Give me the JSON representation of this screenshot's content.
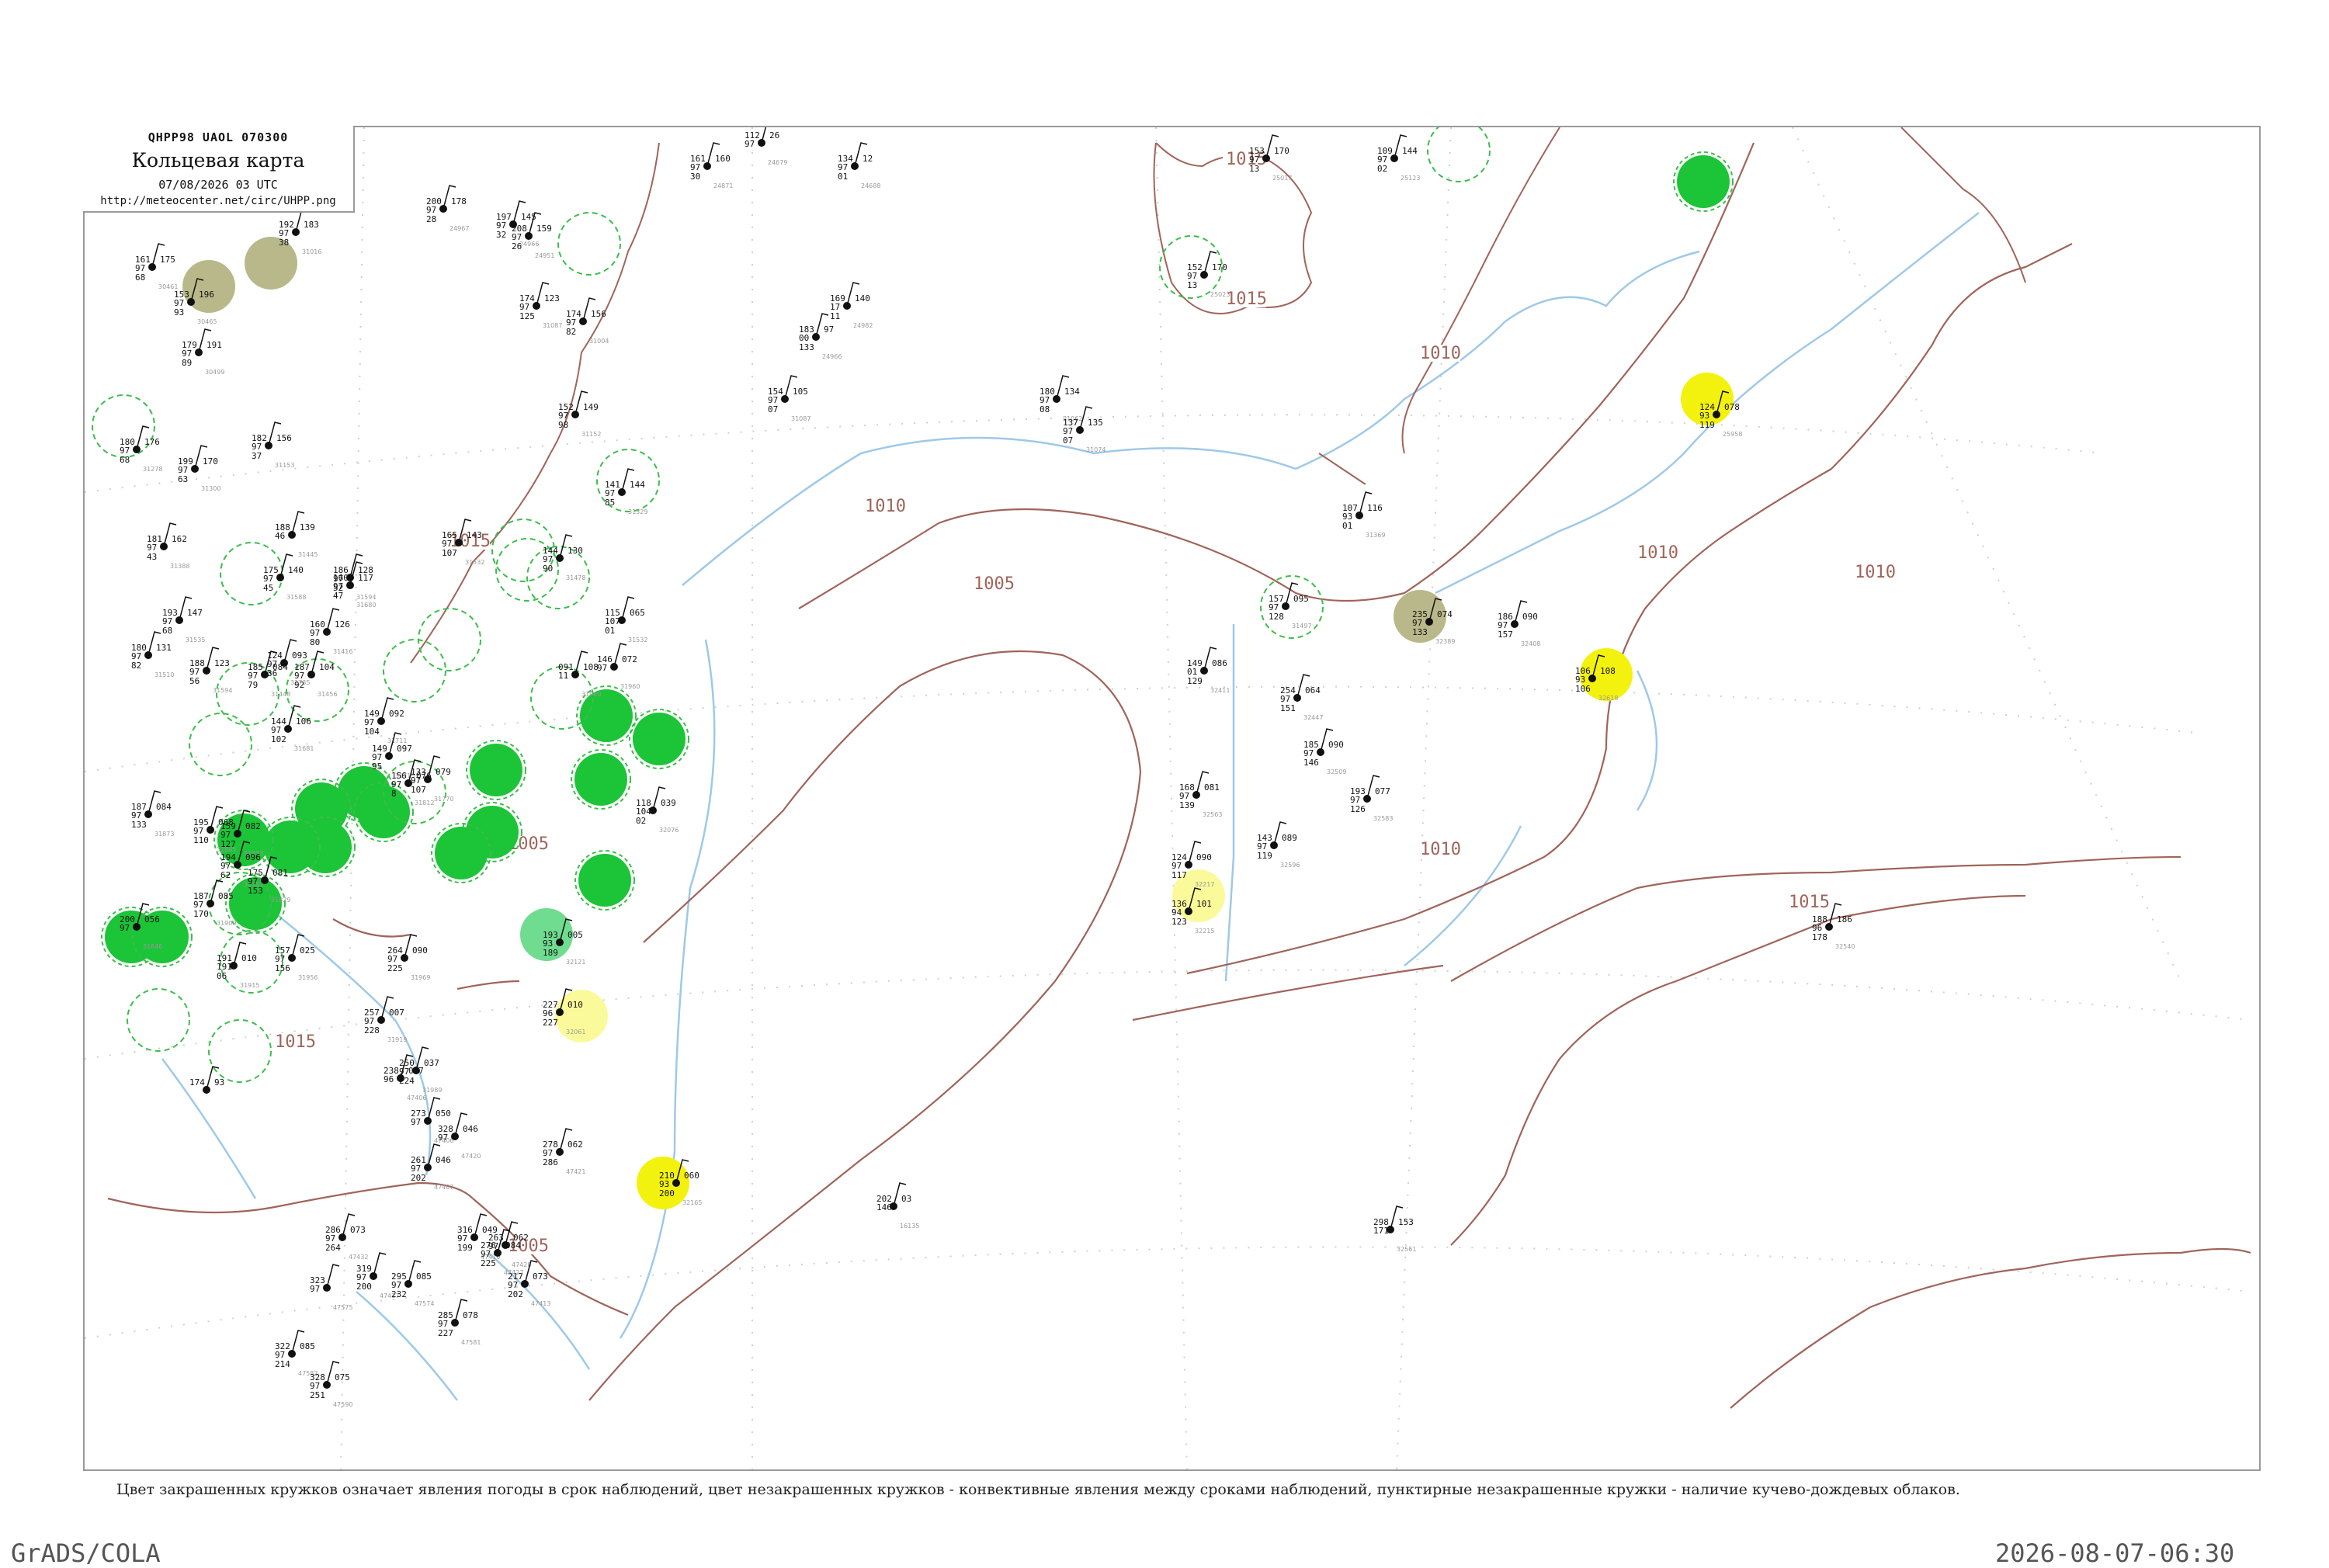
{
  "header": {
    "code_line": "QHPP98  UAOL  070300",
    "title": "Кольцевая карта",
    "datetime": "07/08/2026 03 UTC",
    "url": "http://meteocenter.net/circ/UHPP.png"
  },
  "caption": "Цвет закрашенных кружков означает явления погоды в срок наблюдений, цвет незакрашенных кружков - конвективные явления между сроками наблюдений, пунктирные незакрашенные кружки - наличие кучево-дождевых облаков.",
  "footer": {
    "left": "GrADS/COLA",
    "right": "2026-08-07-06:30"
  },
  "colors": {
    "isobar": "#a0645a",
    "river": "#9ec9e8",
    "frame": "#9a9a9a",
    "rain_fill": "#1cc437",
    "fog_fill": "#f3f20e",
    "haze_fill": "#fafa9a",
    "dust_fill": "#b8b88a",
    "shower_fill": "#6fdc8f",
    "cb_ring": "#3cbd4b"
  },
  "isobar_labels": [
    "1015",
    "1015",
    "1015",
    "1010",
    "1010",
    "1010",
    "1010",
    "1005",
    "1005",
    "1010",
    "1015",
    "1005",
    "1015"
  ],
  "stations": [
    {
      "pres": "183",
      "temp": "97",
      "vis": "00",
      "tdew": "133",
      "id": "24966"
    },
    {
      "pres": "169",
      "temp": "140",
      "vis": "17",
      "tdew": "11",
      "id": "24982"
    },
    {
      "pres": "154",
      "temp": "105",
      "vis": "97",
      "tdew": "07",
      "id": "31087"
    },
    {
      "pres": "180",
      "temp": "134",
      "vis": "97",
      "tdew": "08",
      "id": "31062"
    },
    {
      "pres": "137",
      "temp": "135",
      "vis": "97",
      "tdew": "07",
      "id": "31074"
    },
    {
      "pres": "152",
      "temp": "170",
      "vis": "97",
      "tdew": "13",
      "id": "25023"
    },
    {
      "pres": "153",
      "temp": "170",
      "vis": "97",
      "tdew": "13",
      "id": "25017"
    },
    {
      "pres": "109",
      "temp": "144",
      "vis": "97",
      "tdew": "02",
      "id": "25123"
    },
    {
      "pres": "124",
      "temp": "078",
      "vis": "93",
      "tdew": "119",
      "id": "25958"
    },
    {
      "pres": "107",
      "temp": "116",
      "vis": "93",
      "tdew": "01",
      "id": "31369"
    },
    {
      "pres": "157",
      "temp": "095",
      "vis": "97",
      "tdew": "128",
      "id": "31497"
    },
    {
      "pres": "235",
      "temp": "074",
      "vis": "97",
      "tdew": "133",
      "id": "32389"
    },
    {
      "pres": "186",
      "temp": "090",
      "vis": "97",
      "tdew": "157",
      "id": "32408"
    },
    {
      "pres": "106",
      "temp": "108",
      "vis": "93",
      "tdew": "106",
      "id": "32618"
    },
    {
      "pres": "254",
      "temp": "064",
      "vis": "97",
      "tdew": "151",
      "id": "32447"
    },
    {
      "pres": "185",
      "temp": "090",
      "vis": "97",
      "tdew": "146",
      "id": "32509"
    },
    {
      "pres": "193",
      "temp": "077",
      "vis": "97",
      "tdew": "126",
      "id": "32583"
    },
    {
      "pres": "168",
      "temp": "081",
      "vis": "97",
      "tdew": "139",
      "id": "32563"
    },
    {
      "pres": "143",
      "temp": "089",
      "vis": "97",
      "tdew": "119",
      "id": "32596"
    },
    {
      "pres": "124",
      "temp": "090",
      "vis": "97",
      "tdew": "117",
      "id": "32217"
    },
    {
      "pres": "136",
      "temp": "101",
      "vis": "94",
      "tdew": "123",
      "id": "32215"
    },
    {
      "pres": "188",
      "temp": "186",
      "vis": "96",
      "tdew": "178",
      "id": "32540"
    },
    {
      "pres": "149",
      "temp": "086",
      "vis": "01",
      "tdew": "129",
      "id": "32411"
    },
    {
      "pres": "202",
      "temp": "03",
      "vis": "146",
      "tdew": "",
      "id": "16135"
    },
    {
      "pres": "298",
      "temp": "153",
      "vis": "171",
      "tdew": "",
      "id": "32561"
    },
    {
      "pres": "210",
      "temp": "060",
      "vis": "93",
      "tdew": "200",
      "id": "32165"
    },
    {
      "pres": "227",
      "temp": "010",
      "vis": "96",
      "tdew": "227",
      "id": "32061"
    },
    {
      "pres": "193",
      "temp": "005",
      "vis": "93",
      "tdew": "189",
      "id": "32121"
    },
    {
      "pres": "146",
      "temp": "072",
      "vis": "97",
      "tdew": "",
      "id": "31960"
    },
    {
      "pres": "118",
      "temp": "039",
      "vis": "104",
      "tdew": "02",
      "id": "32076"
    },
    {
      "pres": "091",
      "temp": "108",
      "vis": "11",
      "tdew": "",
      "id": "31960"
    },
    {
      "pres": "115",
      "temp": "065",
      "vis": "107",
      "tdew": "01",
      "id": "31532"
    },
    {
      "pres": "144",
      "temp": "130",
      "vis": "97",
      "tdew": "90",
      "id": "31478"
    },
    {
      "pres": "141",
      "temp": "144",
      "vis": "97",
      "tdew": "85",
      "id": "31329"
    },
    {
      "pres": "152",
      "temp": "149",
      "vis": "97",
      "tdew": "98",
      "id": "31152"
    },
    {
      "pres": "174",
      "temp": "156",
      "vis": "97",
      "tdew": "82",
      "id": "31004"
    },
    {
      "pres": "112",
      "temp": "26",
      "vis": "97",
      "tdew": "",
      "id": "24679"
    },
    {
      "pres": "134",
      "temp": "12",
      "vis": "97",
      "tdew": "01",
      "id": "24688"
    },
    {
      "pres": "161",
      "temp": "160",
      "vis": "97",
      "tdew": "30",
      "id": "24871"
    },
    {
      "pres": "211",
      "temp": "168",
      "vis": "97",
      "tdew": "38",
      "id": "24959"
    },
    {
      "pres": "200",
      "temp": "178",
      "vis": "97",
      "tdew": "28",
      "id": "24967"
    },
    {
      "pres": "197",
      "temp": "145",
      "vis": "97",
      "tdew": "32",
      "id": "24966"
    },
    {
      "pres": "208",
      "temp": "159",
      "vis": "97",
      "tdew": "26",
      "id": "24951"
    },
    {
      "pres": "192",
      "temp": "183",
      "vis": "97",
      "tdew": "38",
      "id": "31016"
    },
    {
      "pres": "174",
      "temp": "123",
      "vis": "97",
      "tdew": "125",
      "id": "31087"
    },
    {
      "pres": "161",
      "temp": "175",
      "vis": "97",
      "tdew": "68",
      "id": "30461"
    },
    {
      "pres": "153",
      "temp": "196",
      "vis": "97",
      "tdew": "93",
      "id": "30465"
    },
    {
      "pres": "179",
      "temp": "191",
      "vis": "97",
      "tdew": "89",
      "id": "30499"
    },
    {
      "pres": "180",
      "temp": "176",
      "vis": "97",
      "tdew": "68",
      "id": "31278"
    },
    {
      "pres": "199",
      "temp": "170",
      "vis": "97",
      "tdew": "63",
      "id": "31300"
    },
    {
      "pres": "182",
      "temp": "156",
      "vis": "97",
      "tdew": "37",
      "id": "31153"
    },
    {
      "pres": "181",
      "temp": "162",
      "vis": "97",
      "tdew": "43",
      "id": "31388"
    },
    {
      "pres": "188",
      "temp": "139",
      "vis": "46",
      "tdew": "",
      "id": "31445"
    },
    {
      "pres": "175",
      "temp": "140",
      "vis": "97",
      "tdew": "45",
      "id": "31588"
    },
    {
      "pres": "186",
      "temp": "128",
      "vis": "97",
      "tdew": "52",
      "id": "31594"
    },
    {
      "pres": "160",
      "temp": "117",
      "vis": "97",
      "tdew": "47",
      "id": "31680"
    },
    {
      "pres": "165",
      "temp": "143",
      "vis": "97",
      "tdew": "107",
      "id": "31532"
    },
    {
      "pres": "193",
      "temp": "147",
      "vis": "97",
      "tdew": "68",
      "id": "31535"
    },
    {
      "pres": "180",
      "temp": "131",
      "vis": "97",
      "tdew": "82",
      "id": "31510"
    },
    {
      "pres": "188",
      "temp": "123",
      "vis": "97",
      "tdew": "56",
      "id": "31594"
    },
    {
      "pres": "124",
      "temp": "093",
      "vis": "97",
      "tdew": "36",
      "id": "31735"
    },
    {
      "pres": "160",
      "temp": "126",
      "vis": "97",
      "tdew": "80",
      "id": "31416"
    },
    {
      "pres": "185",
      "temp": "084",
      "vis": "97",
      "tdew": "79",
      "id": "31448"
    },
    {
      "pres": "187",
      "temp": "104",
      "vis": "97",
      "tdew": "92",
      "id": "31456"
    },
    {
      "pres": "144",
      "temp": "106",
      "vis": "97",
      "tdew": "102",
      "id": "31681"
    },
    {
      "pres": "149",
      "temp": "092",
      "vis": "97",
      "tdew": "104",
      "id": "31711"
    },
    {
      "pres": "149",
      "temp": "097",
      "vis": "97",
      "tdew": "95",
      "id": "31719"
    },
    {
      "pres": "133",
      "temp": "079",
      "vis": "97",
      "tdew": "107",
      "id": "31770"
    },
    {
      "pres": "156",
      "temp": "076",
      "vis": "97",
      "tdew": "8",
      "id": "31812"
    },
    {
      "pres": "195",
      "temp": "068",
      "vis": "97",
      "tdew": "110",
      "id": "31845"
    },
    {
      "pres": "159",
      "temp": "082",
      "vis": "97",
      "tdew": "127",
      "id": "31833"
    },
    {
      "pres": "194",
      "temp": "096",
      "vis": "97",
      "tdew": "62",
      "id": "31707"
    },
    {
      "pres": "175",
      "temp": "081",
      "vis": "97",
      "tdew": "153",
      "id": "31829"
    },
    {
      "pres": "187",
      "temp": "084",
      "vis": "97",
      "tdew": "133",
      "id": "31873"
    },
    {
      "pres": "187",
      "temp": "085",
      "vis": "97",
      "tdew": "170",
      "id": "31909"
    },
    {
      "pres": "200",
      "temp": "056",
      "vis": "97",
      "tdew": "",
      "id": "31846"
    },
    {
      "pres": "191",
      "temp": "010",
      "vis": "191",
      "tdew": "06",
      "id": "31915"
    },
    {
      "pres": "157",
      "temp": "025",
      "vis": "97",
      "tdew": "156",
      "id": "31956"
    },
    {
      "pres": "264",
      "temp": "090",
      "vis": "97",
      "tdew": "225",
      "id": "31969"
    },
    {
      "pres": "257",
      "temp": "007",
      "vis": "97",
      "tdew": "228",
      "id": "31919"
    },
    {
      "pres": "250",
      "temp": "037",
      "vis": "97",
      "tdew": "224",
      "id": "31989"
    },
    {
      "pres": "238",
      "temp": "027",
      "vis": "96",
      "tdew": "",
      "id": "47406"
    },
    {
      "pres": "174",
      "temp": "93",
      "vis": "",
      "tdew": "",
      "id": ""
    },
    {
      "pres": "273",
      "temp": "050",
      "vis": "97",
      "tdew": "",
      "id": "47406"
    },
    {
      "pres": "328",
      "temp": "046",
      "vis": "97",
      "tdew": "",
      "id": "47420"
    },
    {
      "pres": "261",
      "temp": "046",
      "vis": "97",
      "tdew": "202",
      "id": "47407"
    },
    {
      "pres": "316",
      "temp": "049",
      "vis": "97",
      "tdew": "199",
      "id": "47410"
    },
    {
      "pres": "263",
      "temp": "062",
      "vis": "97",
      "tdew": "",
      "id": "47428"
    },
    {
      "pres": "278",
      "temp": "062",
      "vis": "97",
      "tdew": "286",
      "id": "47421"
    },
    {
      "pres": "217",
      "temp": "073",
      "vis": "97",
      "tdew": "202",
      "id": "47413"
    },
    {
      "pres": "276",
      "temp": "084",
      "vis": "97",
      "tdew": "225",
      "id": "47427"
    },
    {
      "pres": "286",
      "temp": "073",
      "vis": "97",
      "tdew": "264",
      "id": "47432"
    },
    {
      "pres": "319",
      "temp": "",
      "vis": "97",
      "tdew": "200",
      "id": "47417"
    },
    {
      "pres": "295",
      "temp": "085",
      "vis": "97",
      "tdew": "232",
      "id": "47574"
    },
    {
      "pres": "323",
      "temp": "",
      "vis": "97",
      "tdew": "",
      "id": "47575"
    },
    {
      "pres": "285",
      "temp": "078",
      "vis": "97",
      "tdew": "227",
      "id": "47581"
    },
    {
      "pres": "322",
      "temp": "085",
      "vis": "97",
      "tdew": "214",
      "id": "47582"
    },
    {
      "pres": "328",
      "temp": "075",
      "vis": "97",
      "tdew": "251",
      "id": "47590"
    }
  ]
}
